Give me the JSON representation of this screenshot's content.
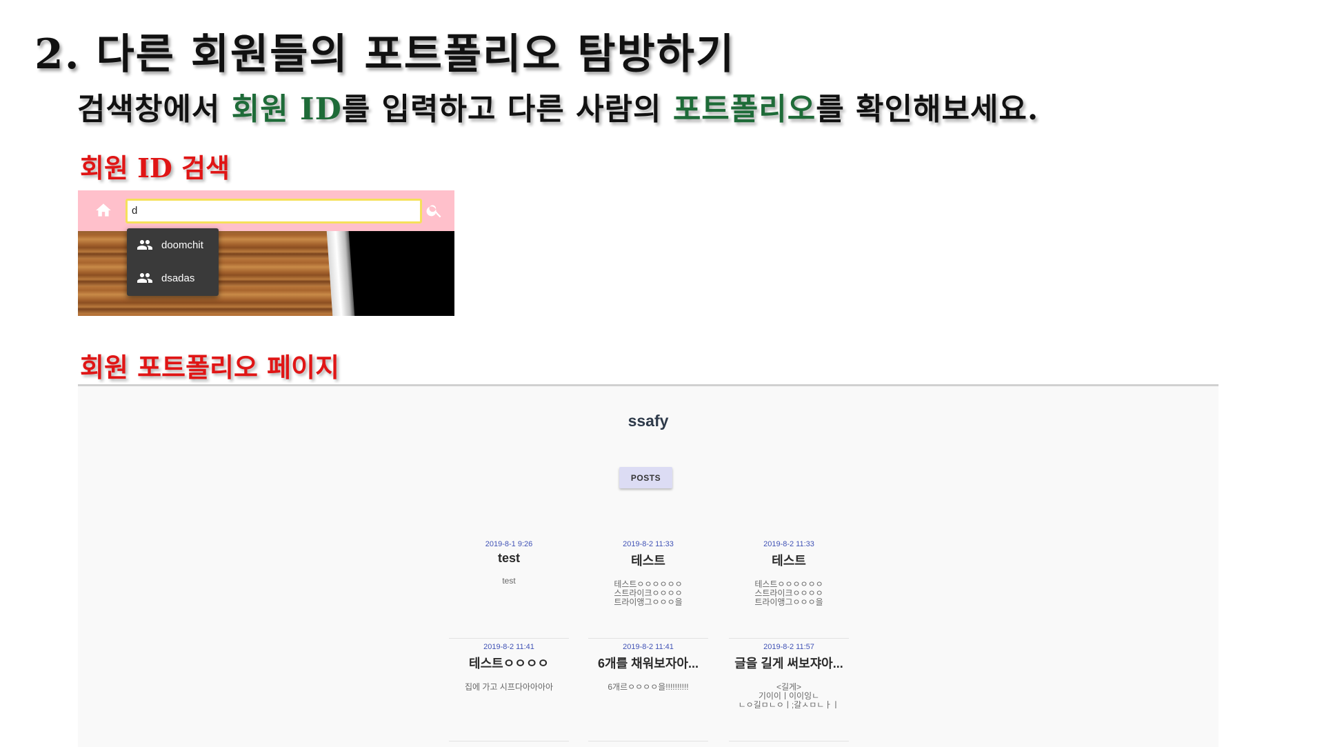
{
  "slide": {
    "title": "2. 다른 회원들의 포트폴리오 탐방하기",
    "subtitle": {
      "part1": "검색창에서 ",
      "highlight1": "회원 ID",
      "part2": "를 입력하고 다른 사람의 ",
      "highlight2": "포트폴리오",
      "part3": "를 확인해보세요."
    },
    "highlight_color": "#1e6b38",
    "label_color": "#e01515",
    "search_section_label": "회원 ID 검색",
    "portfolio_section_label": "회원 포트폴리오 페이지"
  },
  "search_screenshot": {
    "toolbar_color": "#ffc0cb",
    "home_icon": "home-icon",
    "search_icon": "search-icon",
    "search_value": "d",
    "results": [
      {
        "icon": "people-icon",
        "label": "doomchit"
      },
      {
        "icon": "people-icon",
        "label": "dsadas"
      }
    ]
  },
  "portfolio": {
    "user_name": "ssafy",
    "posts_button": "POSTS",
    "posts": [
      {
        "date": "2019-8-1 9:26",
        "title": "test",
        "body": "test"
      },
      {
        "date": "2019-8-2 11:33",
        "title": "테스트",
        "body": "테스트ㅇㅇㅇㅇㅇㅇ\n스트라이크ㅇㅇㅇㅇ\n트라이앵그ㅇㅇㅇ을"
      },
      {
        "date": "2019-8-2 11:33",
        "title": "테스트",
        "body": "테스트ㅇㅇㅇㅇㅇㅇ\n스트라이크ㅇㅇㅇㅇ\n트라이앵그ㅇㅇㅇ을"
      },
      {
        "date": "2019-8-2 11:41",
        "title": "테스트ㅇㅇㅇㅇ",
        "body": "집에 가고 시프다아아아아"
      },
      {
        "date": "2019-8-2 11:41",
        "title": "6개를 채워보자아...",
        "body": "6개르ㅇㅇㅇㅇ을!!!!!!!!!!"
      },
      {
        "date": "2019-8-2 11:57",
        "title": "글을 길게 써보쟈아...",
        "body": "<길게>\n기이이ㅣ이이잉ㄴ\nㄴㅇ길ㅁㄴㅇㅣ;갈ㅅㅁㄴㅏㅣ"
      }
    ]
  }
}
